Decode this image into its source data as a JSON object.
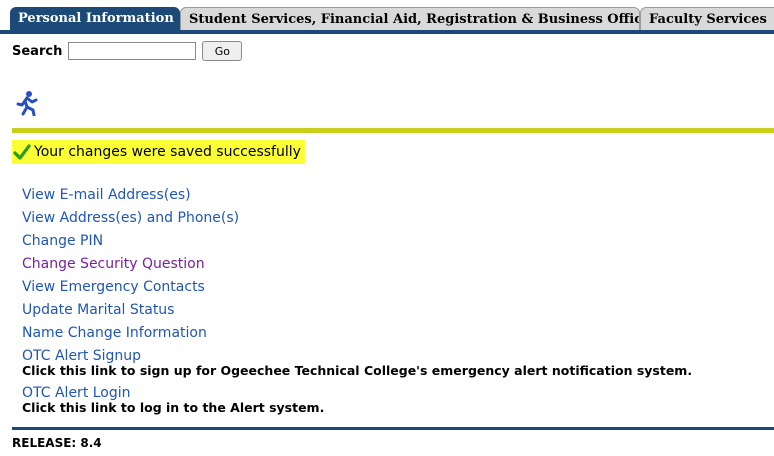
{
  "tabs": [
    {
      "label": "Personal Information",
      "active": true
    },
    {
      "label": "Student Services, Financial Aid, Registration & Business Office",
      "active": false
    },
    {
      "label": "Faculty Services",
      "active": false
    }
  ],
  "search": {
    "label": "Search",
    "value": "",
    "go_label": "Go"
  },
  "icons": {
    "runner": "running-man-icon",
    "check": "checkmark-icon"
  },
  "status": {
    "message": "Your changes were saved successfully"
  },
  "menu": {
    "items": [
      {
        "label": "View E-mail Address(es)",
        "description": ""
      },
      {
        "label": "View Address(es) and Phone(s)",
        "description": ""
      },
      {
        "label": "Change PIN",
        "description": ""
      },
      {
        "label": "Change Security Question",
        "description": ""
      },
      {
        "label": "View Emergency Contacts",
        "description": ""
      },
      {
        "label": "Update Marital Status",
        "description": ""
      },
      {
        "label": "Name Change Information",
        "description": ""
      },
      {
        "label": "OTC Alert Signup",
        "description": "Click this link to sign up for Ogeechee Technical College's emergency alert notification system."
      },
      {
        "label": "OTC Alert Login",
        "description": "Click this link to log in to the Alert system."
      }
    ]
  },
  "footer": {
    "release": "RELEASE: 8.4"
  },
  "colors": {
    "tab_active_bg": "#1c4a78",
    "link": "#1f56b8",
    "visited_link": "#7a1fa0",
    "success_highlight": "#fcff33",
    "divider_bar": "#c9cf1a"
  }
}
